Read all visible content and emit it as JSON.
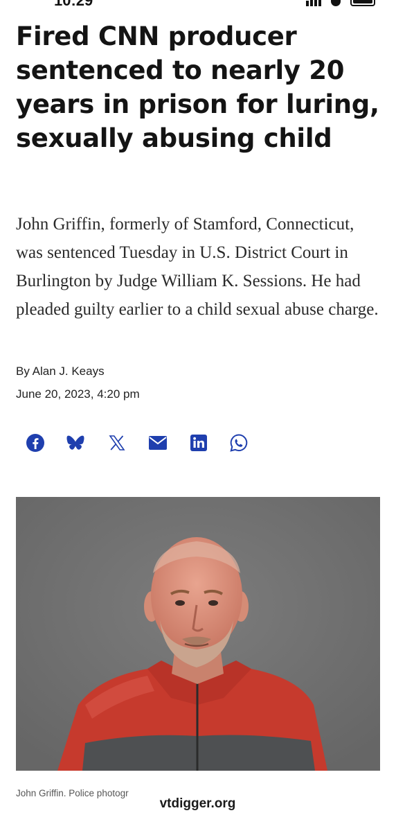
{
  "status_bar": {
    "time": "10:29"
  },
  "article": {
    "headline": "Fired CNN producer sentenced to nearly 20 years in prison for luring, sexually abusing child",
    "dek": "John Griffin, formerly of Stamford, Connecticut, was sentenced Tuesday in U.S. District Court in Burlington by Judge William K. Sessions. He had pleaded guilty earlier to a child sexual abuse charge.",
    "byline": "By Alan J. Keays",
    "date": "June 20, 2023, 4:20 pm"
  },
  "share": {
    "icons": [
      "facebook-icon",
      "bluesky-icon",
      "x-icon",
      "email-icon",
      "linkedin-icon",
      "whatsapp-icon"
    ],
    "color": "#1f3fae"
  },
  "photo": {
    "caption": "John Griffin. Police photogr"
  },
  "source": {
    "label": "vtdigger.org"
  }
}
